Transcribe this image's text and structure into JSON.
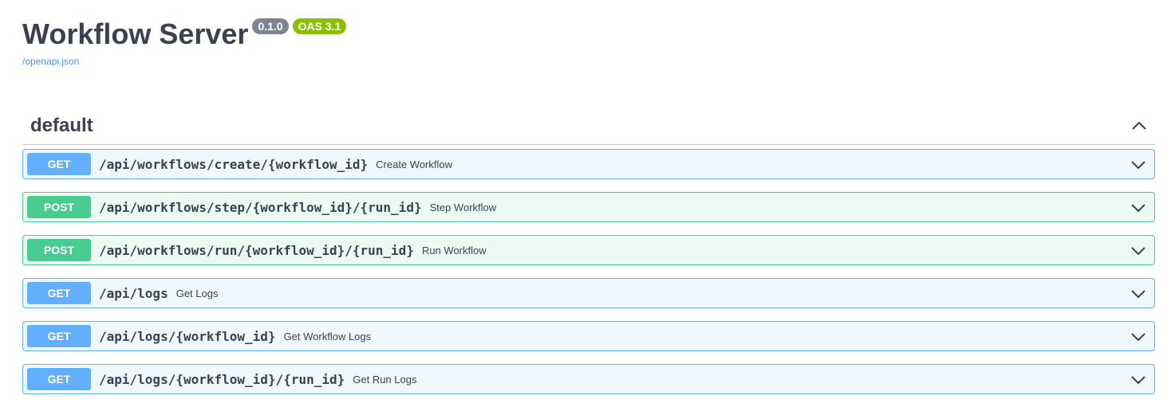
{
  "info": {
    "title": "Workflow Server",
    "version": "0.1.0",
    "oas_badge": "OAS 3.1",
    "spec_link": "/openapi.json"
  },
  "section": {
    "title": "default",
    "operations": [
      {
        "method": "GET",
        "path": "/api/workflows/create/{workflow_id}",
        "summary": "Create Workflow"
      },
      {
        "method": "POST",
        "path": "/api/workflows/step/{workflow_id}/{run_id}",
        "summary": "Step Workflow"
      },
      {
        "method": "POST",
        "path": "/api/workflows/run/{workflow_id}/{run_id}",
        "summary": "Run Workflow"
      },
      {
        "method": "GET",
        "path": "/api/logs",
        "summary": "Get Logs"
      },
      {
        "method": "GET",
        "path": "/api/logs/{workflow_id}",
        "summary": "Get Workflow Logs"
      },
      {
        "method": "GET",
        "path": "/api/logs/{workflow_id}/{run_id}",
        "summary": "Get Run Logs"
      }
    ]
  },
  "icons": {
    "collapse": "chevron-up-icon",
    "expand": "chevron-down-icon"
  },
  "colors": {
    "get": "#61affe",
    "post": "#49cc90",
    "version_badge": "#7d8492",
    "oas_badge": "#89bf04",
    "link": "#4990e2"
  }
}
